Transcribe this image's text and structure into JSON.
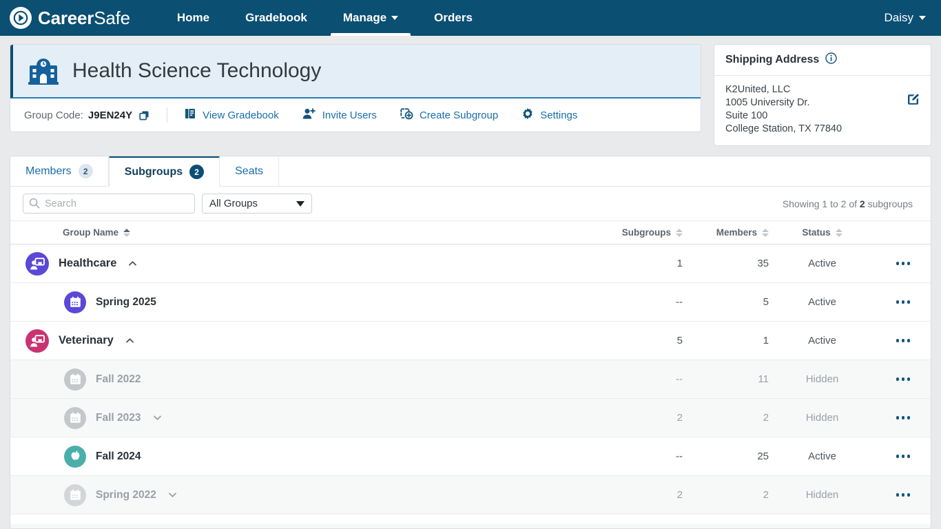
{
  "navbar": {
    "brand_bold": "Career",
    "brand_light": "Safe",
    "logo_icon": "chevron-circle-logo",
    "links": [
      {
        "label": "Home",
        "active": false,
        "caret": false
      },
      {
        "label": "Gradebook",
        "active": false,
        "caret": false
      },
      {
        "label": "Manage",
        "active": true,
        "caret": true
      },
      {
        "label": "Orders",
        "active": false,
        "caret": false
      }
    ],
    "user": {
      "label": "Daisy",
      "caret": true
    }
  },
  "group": {
    "icon": "school-building-icon",
    "title": "Health Science Technology",
    "code_label": "Group Code:",
    "code_value": "J9EN24Y",
    "copy_icon": "copy-icon",
    "actions": [
      {
        "label": "View Gradebook",
        "icon": "gradebook-icon"
      },
      {
        "label": "Invite Users",
        "icon": "user-plus-icon"
      },
      {
        "label": "Create Subgroup",
        "icon": "create-subgroup-icon"
      },
      {
        "label": "Settings",
        "icon": "gear-icon"
      }
    ]
  },
  "shipping": {
    "title": "Shipping Address",
    "info_icon": "info-circle-icon",
    "edit_icon": "edit-pencil-icon",
    "lines": [
      "K2United, LLC",
      "1005 University Dr.",
      "Suite 100",
      "College Station, TX 77840"
    ]
  },
  "tabs": [
    {
      "label": "Members",
      "badge": "2",
      "active": false
    },
    {
      "label": "Subgroups",
      "badge": "2",
      "active": true
    },
    {
      "label": "Seats",
      "badge": "",
      "active": false
    }
  ],
  "filters": {
    "search_placeholder": "Search",
    "search_value": "",
    "search_icon": "search-icon",
    "group_filter_value": "All Groups",
    "group_filter_options": [
      "All Groups"
    ],
    "showing_prefix": "Showing 1 to 2 of ",
    "showing_count": "2",
    "showing_suffix": " subgroups"
  },
  "table": {
    "columns": [
      {
        "key": "name",
        "label": "Group Name",
        "sort": "asc"
      },
      {
        "key": "subgroups",
        "label": "Subgroups",
        "sort": "none"
      },
      {
        "key": "members",
        "label": "Members",
        "sort": "none"
      },
      {
        "key": "status",
        "label": "Status",
        "sort": "none"
      }
    ],
    "menu_icon": "row-menu-dots-icon",
    "rows": [
      {
        "name": "Healthcare",
        "level": "parent",
        "avatar_icon": "presentation-person-icon",
        "avatar_color": "#5b48d6",
        "expander": "chevron-up",
        "subgroups": "1",
        "members": "35",
        "status": "Active",
        "hidden": false
      },
      {
        "name": "Spring 2025",
        "level": "child",
        "avatar_icon": "calendar-icon",
        "avatar_color": "#5b48d6",
        "expander": "none",
        "subgroups": "--",
        "members": "5",
        "status": "Active",
        "hidden": false
      },
      {
        "name": "Veterinary",
        "level": "parent",
        "avatar_icon": "presentation-person-icon",
        "avatar_color": "#c93371",
        "expander": "chevron-up",
        "subgroups": "5",
        "members": "1",
        "status": "Active",
        "hidden": false
      },
      {
        "name": "Fall 2022",
        "level": "child",
        "avatar_icon": "calendar-icon",
        "avatar_color": "#c5c8cb",
        "expander": "none",
        "subgroups": "--",
        "members": "11",
        "status": "Hidden",
        "hidden": true
      },
      {
        "name": "Fall 2023",
        "level": "child",
        "avatar_icon": "calendar-icon",
        "avatar_color": "#c5c8cb",
        "expander": "chevron-down",
        "subgroups": "2",
        "members": "2",
        "status": "Hidden",
        "hidden": true
      },
      {
        "name": "Fall 2024",
        "level": "child",
        "avatar_icon": "apple-icon",
        "avatar_color": "#4aafa8",
        "expander": "none",
        "subgroups": "--",
        "members": "25",
        "status": "Active",
        "hidden": false
      },
      {
        "name": "Spring 2022",
        "level": "child",
        "avatar_icon": "calendar-icon",
        "avatar_color": "#d3d6d9",
        "expander": "chevron-down",
        "subgroups": "2",
        "members": "2",
        "status": "Hidden",
        "hidden": true
      }
    ]
  },
  "colors": {
    "brand_navy": "#0b4f73",
    "link_blue": "#1a6ea8",
    "header_band": "#e4eef7",
    "purple": "#5b48d6",
    "magenta": "#c93371",
    "teal": "#4aafa8",
    "grey_avatar": "#c5c8cb"
  }
}
